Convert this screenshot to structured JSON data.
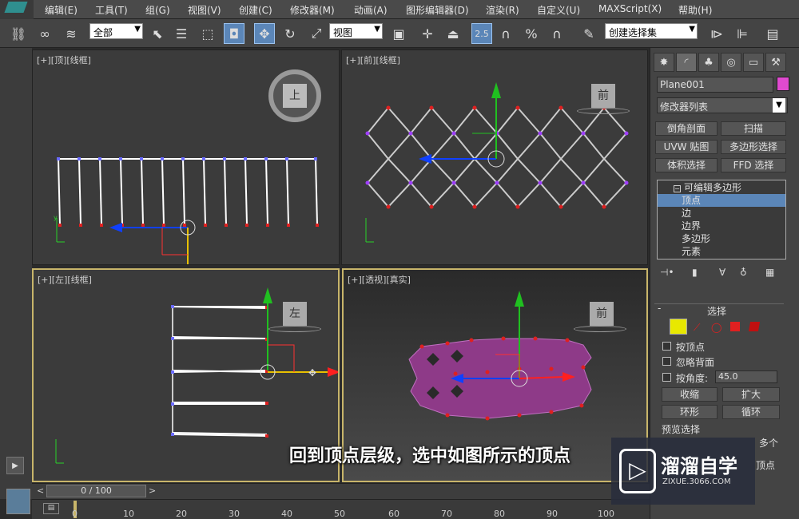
{
  "menu": [
    "编辑(E)",
    "工具(T)",
    "组(G)",
    "视图(V)",
    "创建(C)",
    "修改器(M)",
    "动画(A)",
    "图形编辑器(D)",
    "渲染(R)",
    "自定义(U)",
    "MAXScript(X)",
    "帮助(H)"
  ],
  "toolbar": {
    "filter_value": "全部",
    "refcoord_value": "视图",
    "snap_value": "2.5",
    "selection_set_value": "创建选择集"
  },
  "viewports": {
    "top": {
      "label": "[+][顶][线框]",
      "cube_label": "上"
    },
    "front": {
      "label": "[+][前][线框]",
      "cube_label": "前"
    },
    "left": {
      "label": "[+][左][线框]",
      "cube_label": "左"
    },
    "persp": {
      "label": "[+][透视][真实]",
      "cube_label": "前"
    }
  },
  "command_panel": {
    "object_name": "Plane001",
    "object_color": "#e04ad0",
    "modifier_list": "修改器列表",
    "buttons": [
      "倒角剖面",
      "扫描",
      "UVW 贴图",
      "多边形选择",
      "体积选择",
      "FFD 选择"
    ],
    "stack": {
      "root": "可编辑多边形",
      "items": [
        "顶点",
        "边",
        "边界",
        "多边形",
        "元素"
      ],
      "selected_index": 0
    },
    "rollout_title": "选择",
    "by_vertex": "按顶点",
    "ignore_backfacing": "忽略背面",
    "by_angle": "按角度:",
    "angle_value": "45.0",
    "shrink": "收缩",
    "grow": "扩大",
    "ring": "环形",
    "loop": "循环",
    "preview_selection": "预览选择",
    "multi": "多个",
    "vertex_tail": "顶点"
  },
  "timeline": {
    "slider_text": "0 / 100",
    "ticks": [
      "0",
      "10",
      "20",
      "30",
      "40",
      "50",
      "60",
      "70",
      "80",
      "90",
      "100"
    ]
  },
  "subtitle": "回到顶点层级，选中如图所示的顶点",
  "watermark": {
    "brand": "溜溜自学",
    "url": "ZIXUE.3066.COM"
  },
  "colors": {
    "vertex": "#e02020",
    "wire": "#ffffff",
    "mesh": "#8e3a88",
    "active_border": "#c8b56a",
    "selection_blue": "#5b86b8"
  }
}
